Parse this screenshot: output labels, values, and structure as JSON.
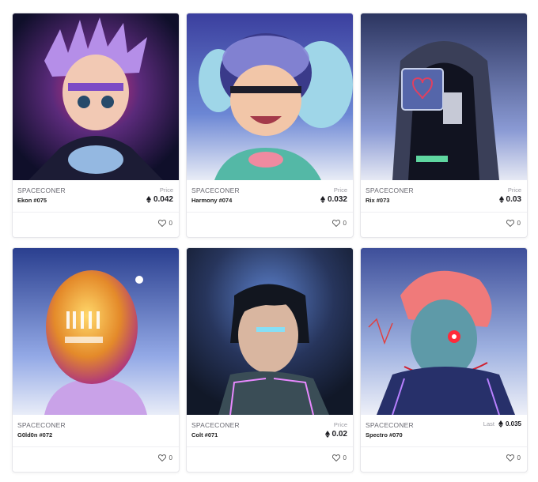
{
  "cards": [
    {
      "collection": "SPACECONER",
      "name": "Ekon #075",
      "price_label": "Price",
      "price": "0.042",
      "likes": "0",
      "art": "purple-hair-kid-portrait",
      "accent": "#5a3b8c"
    },
    {
      "collection": "SPACECONER",
      "name": "Harmony #074",
      "price_label": "Price",
      "price": "0.032",
      "likes": "0",
      "art": "helmet-girl-portrait",
      "accent": "#3a5aa6"
    },
    {
      "collection": "SPACECONER",
      "name": "Rix #073",
      "price_label": "Price",
      "price": "0.03",
      "likes": "0",
      "art": "hooded-robot-portrait",
      "accent": "#2c3560"
    },
    {
      "collection": "SPACECONER",
      "name": "G0ld0n #072",
      "price_label": "",
      "price": "",
      "likes": "0",
      "art": "gold-helmet-portrait",
      "accent": "#c9a03a"
    },
    {
      "collection": "SPACECONER",
      "name": "Colt #071",
      "price_label": "Price",
      "price": "0.02",
      "likes": "0",
      "art": "cyber-man-portrait",
      "accent": "#27355c"
    },
    {
      "collection": "SPACECONER",
      "name": "Spectro #070",
      "price_label": "Last",
      "price": "0.035",
      "likes": "0",
      "art": "cyborg-redhead-portrait",
      "accent": "#3e4f9a"
    }
  ],
  "colors": {
    "border": "#e6e6ea",
    "text_muted": "#6a6a72",
    "text_dark": "#1d1d22"
  }
}
